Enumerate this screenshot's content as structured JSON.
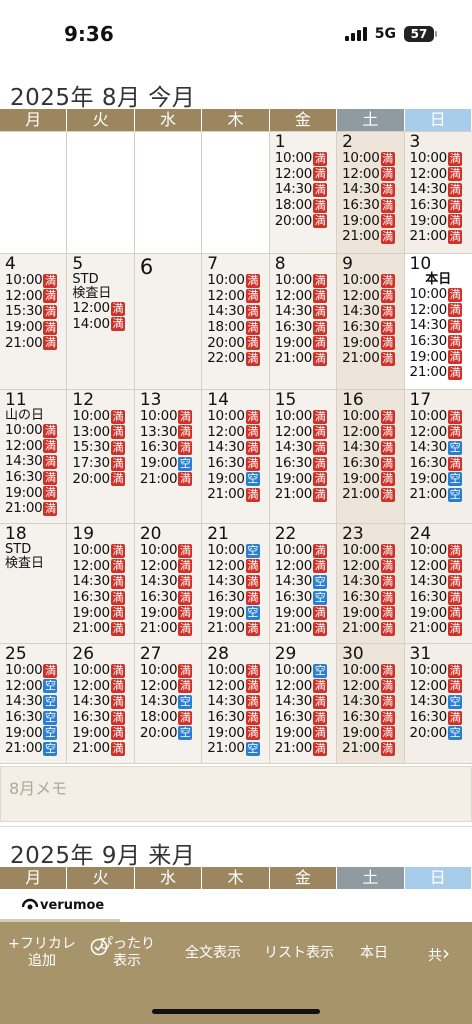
{
  "status": {
    "time": "9:36",
    "network": "5G",
    "battery": "57"
  },
  "august": {
    "title": "2025年 8月 今月",
    "memo_placeholder": "8月メモ"
  },
  "september": {
    "title": "2025年 9月 来月"
  },
  "weekdays": [
    "月",
    "火",
    "水",
    "木",
    "金",
    "土",
    "日"
  ],
  "colors": {
    "header": "#9c8660",
    "sat": "#8f9ba0",
    "sun": "#a8cdea",
    "full": "#d0322a",
    "open": "#2a7fd2",
    "toolbar": "#a8946b"
  },
  "weeks": [
    [
      null,
      null,
      null,
      null,
      {
        "day": "1",
        "slots": [
          [
            "10:00",
            "満"
          ],
          [
            "12:00",
            "満"
          ],
          [
            "14:30",
            "満"
          ],
          [
            "18:00",
            "満"
          ],
          [
            "20:00",
            "満"
          ]
        ]
      },
      {
        "day": "2",
        "slots": [
          [
            "10:00",
            "満"
          ],
          [
            "12:00",
            "満"
          ],
          [
            "14:30",
            "満"
          ],
          [
            "16:30",
            "満"
          ],
          [
            "19:00",
            "満"
          ],
          [
            "21:00",
            "満"
          ]
        ]
      },
      {
        "day": "3",
        "slots": [
          [
            "10:00",
            "満"
          ],
          [
            "12:00",
            "満"
          ],
          [
            "14:30",
            "満"
          ],
          [
            "16:30",
            "満"
          ],
          [
            "19:00",
            "満"
          ],
          [
            "21:00",
            "満"
          ]
        ]
      }
    ],
    [
      {
        "day": "4",
        "slots": [
          [
            "10:00",
            "満"
          ],
          [
            "12:00",
            "満"
          ],
          [
            "15:30",
            "満"
          ],
          [
            "19:00",
            "満"
          ],
          [
            "21:00",
            "満"
          ]
        ]
      },
      {
        "day": "5",
        "notes": [
          "STD",
          "検査日"
        ],
        "slots": [
          [
            "12:00",
            "満"
          ],
          [
            "14:00",
            "満"
          ]
        ]
      },
      {
        "day": "6",
        "big": true,
        "slots": []
      },
      {
        "day": "7",
        "slots": [
          [
            "10:00",
            "満"
          ],
          [
            "12:00",
            "満"
          ],
          [
            "14:30",
            "満"
          ],
          [
            "18:00",
            "満"
          ],
          [
            "20:00",
            "満"
          ],
          [
            "22:00",
            "満"
          ]
        ]
      },
      {
        "day": "8",
        "slots": [
          [
            "10:00",
            "満"
          ],
          [
            "12:00",
            "満"
          ],
          [
            "14:30",
            "満"
          ],
          [
            "16:30",
            "満"
          ],
          [
            "19:00",
            "満"
          ],
          [
            "21:00",
            "満"
          ]
        ]
      },
      {
        "day": "9",
        "slots": [
          [
            "10:00",
            "満"
          ],
          [
            "12:00",
            "満"
          ],
          [
            "14:30",
            "満"
          ],
          [
            "16:30",
            "満"
          ],
          [
            "19:00",
            "満"
          ],
          [
            "21:00",
            "満"
          ]
        ]
      },
      {
        "day": "10",
        "today": true,
        "today_label": "本日",
        "slots": [
          [
            "10:00",
            "満"
          ],
          [
            "12:00",
            "満"
          ],
          [
            "14:30",
            "満"
          ],
          [
            "16:30",
            "満"
          ],
          [
            "19:00",
            "満"
          ],
          [
            "21:00",
            "満"
          ]
        ]
      }
    ],
    [
      {
        "day": "11",
        "notes": [
          "山の日"
        ],
        "slots": [
          [
            "10:00",
            "満"
          ],
          [
            "12:00",
            "満"
          ],
          [
            "14:30",
            "満"
          ],
          [
            "16:30",
            "満"
          ],
          [
            "19:00",
            "満"
          ],
          [
            "21:00",
            "満"
          ]
        ]
      },
      {
        "day": "12",
        "slots": [
          [
            "10:00",
            "満"
          ],
          [
            "13:00",
            "満"
          ],
          [
            "15:30",
            "満"
          ],
          [
            "17:30",
            "満"
          ],
          [
            "20:00",
            "満"
          ]
        ]
      },
      {
        "day": "13",
        "slots": [
          [
            "10:00",
            "満"
          ],
          [
            "13:30",
            "満"
          ],
          [
            "16:30",
            "満"
          ],
          [
            "19:00",
            "空"
          ],
          [
            "21:00",
            "満"
          ]
        ]
      },
      {
        "day": "14",
        "slots": [
          [
            "10:00",
            "満"
          ],
          [
            "12:00",
            "満"
          ],
          [
            "14:30",
            "満"
          ],
          [
            "16:30",
            "満"
          ],
          [
            "19:00",
            "空"
          ],
          [
            "21:00",
            "満"
          ]
        ]
      },
      {
        "day": "15",
        "slots": [
          [
            "10:00",
            "満"
          ],
          [
            "12:00",
            "満"
          ],
          [
            "14:30",
            "満"
          ],
          [
            "16:30",
            "満"
          ],
          [
            "19:00",
            "満"
          ],
          [
            "21:00",
            "満"
          ]
        ]
      },
      {
        "day": "16",
        "slots": [
          [
            "10:00",
            "満"
          ],
          [
            "12:00",
            "満"
          ],
          [
            "14:30",
            "満"
          ],
          [
            "16:30",
            "満"
          ],
          [
            "19:00",
            "満"
          ],
          [
            "21:00",
            "満"
          ]
        ]
      },
      {
        "day": "17",
        "slots": [
          [
            "10:00",
            "満"
          ],
          [
            "12:00",
            "満"
          ],
          [
            "14:30",
            "空"
          ],
          [
            "16:30",
            "満"
          ],
          [
            "19:00",
            "空"
          ],
          [
            "21:00",
            "空"
          ]
        ]
      }
    ],
    [
      {
        "day": "18",
        "notes": [
          "STD",
          "検査日"
        ],
        "slots": []
      },
      {
        "day": "19",
        "slots": [
          [
            "10:00",
            "満"
          ],
          [
            "12:00",
            "満"
          ],
          [
            "14:30",
            "満"
          ],
          [
            "16:30",
            "満"
          ],
          [
            "19:00",
            "満"
          ],
          [
            "21:00",
            "満"
          ]
        ]
      },
      {
        "day": "20",
        "slots": [
          [
            "10:00",
            "満"
          ],
          [
            "12:00",
            "満"
          ],
          [
            "14:30",
            "満"
          ],
          [
            "16:30",
            "満"
          ],
          [
            "19:00",
            "満"
          ],
          [
            "21:00",
            "満"
          ]
        ]
      },
      {
        "day": "21",
        "slots": [
          [
            "10:00",
            "空"
          ],
          [
            "12:00",
            "満"
          ],
          [
            "14:30",
            "満"
          ],
          [
            "16:30",
            "満"
          ],
          [
            "19:00",
            "空"
          ],
          [
            "21:00",
            "満"
          ]
        ]
      },
      {
        "day": "22",
        "slots": [
          [
            "10:00",
            "満"
          ],
          [
            "12:00",
            "満"
          ],
          [
            "14:30",
            "空"
          ],
          [
            "16:30",
            "空"
          ],
          [
            "19:00",
            "満"
          ],
          [
            "21:00",
            "満"
          ]
        ]
      },
      {
        "day": "23",
        "slots": [
          [
            "10:00",
            "満"
          ],
          [
            "12:00",
            "満"
          ],
          [
            "14:30",
            "満"
          ],
          [
            "16:30",
            "満"
          ],
          [
            "19:00",
            "満"
          ],
          [
            "21:00",
            "満"
          ]
        ]
      },
      {
        "day": "24",
        "slots": [
          [
            "10:00",
            "満"
          ],
          [
            "12:00",
            "満"
          ],
          [
            "14:30",
            "満"
          ],
          [
            "16:30",
            "満"
          ],
          [
            "19:00",
            "満"
          ],
          [
            "21:00",
            "満"
          ]
        ]
      }
    ],
    [
      {
        "day": "25",
        "slots": [
          [
            "10:00",
            "満"
          ],
          [
            "12:00",
            "空"
          ],
          [
            "14:30",
            "空"
          ],
          [
            "16:30",
            "空"
          ],
          [
            "19:00",
            "空"
          ],
          [
            "21:00",
            "空"
          ]
        ]
      },
      {
        "day": "26",
        "slots": [
          [
            "10:00",
            "満"
          ],
          [
            "12:00",
            "満"
          ],
          [
            "14:30",
            "満"
          ],
          [
            "16:30",
            "満"
          ],
          [
            "19:00",
            "満"
          ],
          [
            "21:00",
            "満"
          ]
        ]
      },
      {
        "day": "27",
        "slots": [
          [
            "10:00",
            "満"
          ],
          [
            "12:00",
            "満"
          ],
          [
            "14:30",
            "空"
          ],
          [
            "18:00",
            "満"
          ],
          [
            "20:00",
            "空"
          ]
        ]
      },
      {
        "day": "28",
        "slots": [
          [
            "10:00",
            "満"
          ],
          [
            "12:00",
            "満"
          ],
          [
            "14:30",
            "満"
          ],
          [
            "16:30",
            "満"
          ],
          [
            "19:00",
            "満"
          ],
          [
            "21:00",
            "空"
          ]
        ]
      },
      {
        "day": "29",
        "slots": [
          [
            "10:00",
            "空"
          ],
          [
            "12:00",
            "満"
          ],
          [
            "14:30",
            "満"
          ],
          [
            "16:30",
            "満"
          ],
          [
            "19:00",
            "満"
          ],
          [
            "21:00",
            "満"
          ]
        ]
      },
      {
        "day": "30",
        "slots": [
          [
            "10:00",
            "満"
          ],
          [
            "12:00",
            "満"
          ],
          [
            "14:30",
            "満"
          ],
          [
            "16:30",
            "満"
          ],
          [
            "19:00",
            "満"
          ],
          [
            "21:00",
            "満"
          ]
        ]
      },
      {
        "day": "31",
        "slots": [
          [
            "10:00",
            "満"
          ],
          [
            "12:00",
            "満"
          ],
          [
            "14:30",
            "空"
          ],
          [
            "16:30",
            "満"
          ],
          [
            "20:00",
            "空"
          ]
        ]
      }
    ]
  ],
  "logo": {
    "text": "verumoe",
    "icon": "eye-icon"
  },
  "toolbar": [
    {
      "l1": "+フリカレ",
      "l2": "追加",
      "icon": null
    },
    {
      "l1": "ぴったり",
      "l2": "表示",
      "icon": "check-circle-icon"
    },
    {
      "l1": "全文表示",
      "l2": "",
      "icon": null
    },
    {
      "l1": "リスト表示",
      "l2": "",
      "icon": null
    },
    {
      "l1": "本日",
      "l2": "",
      "icon": null
    },
    {
      "l1": "共",
      "l2": "",
      "icon": "chevron-right-icon"
    }
  ]
}
